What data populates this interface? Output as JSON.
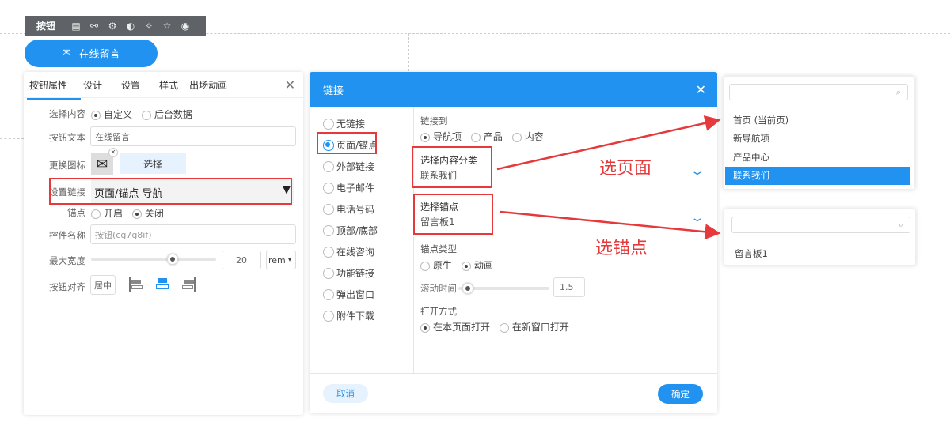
{
  "toolbar": {
    "label": "按钮",
    "icons": [
      "page-settings-icon",
      "link-icon",
      "gear-icon",
      "palette-icon",
      "magic-icon",
      "star-icon",
      "eye-icon"
    ]
  },
  "preview_button": {
    "label": "在线留言",
    "icon": "mail-icon"
  },
  "props_panel": {
    "tabs": [
      "按钮属性",
      "设计",
      "设置",
      "样式",
      "出场动画"
    ],
    "content_label": "选择内容",
    "content_options": [
      "自定义",
      "后台数据"
    ],
    "text_label": "按钮文本",
    "text_value": "在线留言",
    "icon_label": "更换图标",
    "icon_select": "选择",
    "link_label": "设置链接",
    "link_value": "页面/锚点 导航",
    "anchor_label": "锚点",
    "anchor_options": [
      "开启",
      "关闭"
    ],
    "name_label": "控件名称",
    "name_placeholder": "按钮(cg7g8if)",
    "width_label": "最大宽度",
    "width_value": "20",
    "width_unit": "rem",
    "width_slider": 0.65,
    "align_label": "按钮对齐",
    "align_value": "居中"
  },
  "link_dialog": {
    "title": "链接",
    "types": [
      "无链接",
      "页面/锚点",
      "外部链接",
      "电子邮件",
      "电话号码",
      "顶部/底部",
      "在线咨询",
      "功能链接",
      "弹出窗口",
      "附件下载"
    ],
    "link_to_label": "链接到",
    "link_to_options": [
      "导航项",
      "产品",
      "内容"
    ],
    "category_label": "选择内容分类",
    "category_value": "联系我们",
    "anchor_label": "选择锚点",
    "anchor_value": "留言板1",
    "anchor_type_label": "锚点类型",
    "anchor_type_options": [
      "原生",
      "动画"
    ],
    "scroll_label": "滚动时间",
    "scroll_value": "1.5",
    "scroll_slider": 0.1,
    "open_label": "打开方式",
    "open_options": [
      "在本页面打开",
      "在新窗口打开"
    ],
    "cancel": "取消",
    "confirm": "确定"
  },
  "page_dropdown": {
    "items": [
      "首页 (当前页)",
      "新导航项",
      "产品中心",
      "联系我们"
    ],
    "selected": "联系我们"
  },
  "anchor_dropdown": {
    "items": [
      "留言板1"
    ]
  },
  "annotations": {
    "page": "选页面",
    "anchor": "选锚点"
  },
  "colors": {
    "accent": "#2192ef",
    "annotation": "#e5393b"
  }
}
